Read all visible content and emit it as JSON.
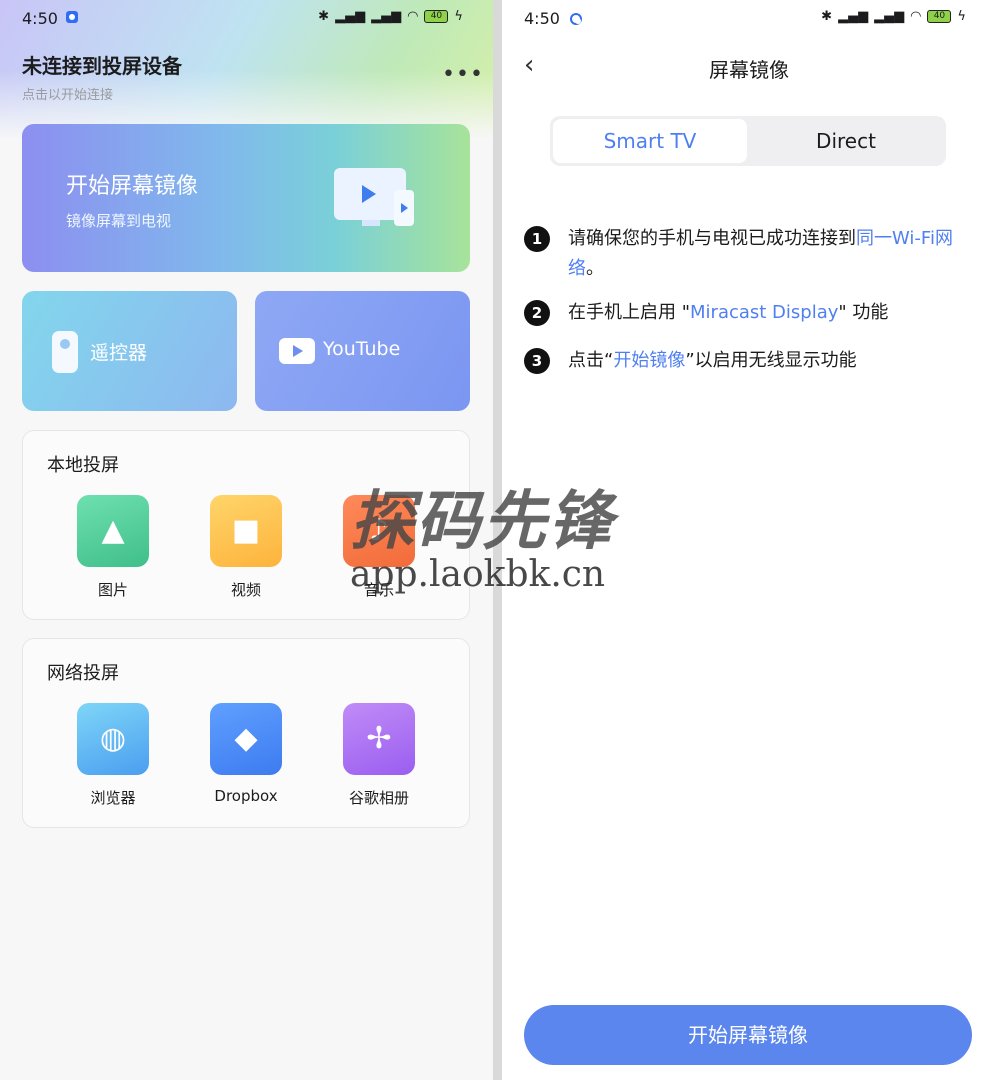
{
  "status": {
    "time": "4:50",
    "battery": "40"
  },
  "left": {
    "title": "未连接到投屏设备",
    "subtitle": "点击以开始连接",
    "more": "•••",
    "mirror_card": {
      "title": "开始屏幕镜像",
      "subtitle": "镜像屏幕到电视"
    },
    "remote_label": "遥控器",
    "youtube_label": "YouTube",
    "local": {
      "heading": "本地投屏",
      "items": [
        "图片",
        "视频",
        "音乐"
      ]
    },
    "network": {
      "heading": "网络投屏",
      "items": [
        "浏览器",
        "Dropbox",
        "谷歌相册"
      ]
    }
  },
  "watermark": {
    "line1": "探码先锋",
    "line2": "app.laokbk.cn"
  },
  "right": {
    "title": "屏幕镜像",
    "tabs": [
      "Smart TV",
      "Direct"
    ],
    "steps": [
      {
        "n": "1",
        "before": "请确保您的手机与电视已成功连接到",
        "hl": "同一Wi-Fi网络",
        "after": "。"
      },
      {
        "n": "2",
        "before": "在手机上启用 \"",
        "hl": "Miracast Display",
        "after": "\" 功能"
      },
      {
        "n": "3",
        "before": "点击“",
        "hl": "开始镜像",
        "after": "”以启用无线显示功能"
      }
    ],
    "cta": "开始屏幕镜像"
  },
  "colors": {
    "accent": "#4f7ff0",
    "cta": "#5a86ee"
  }
}
